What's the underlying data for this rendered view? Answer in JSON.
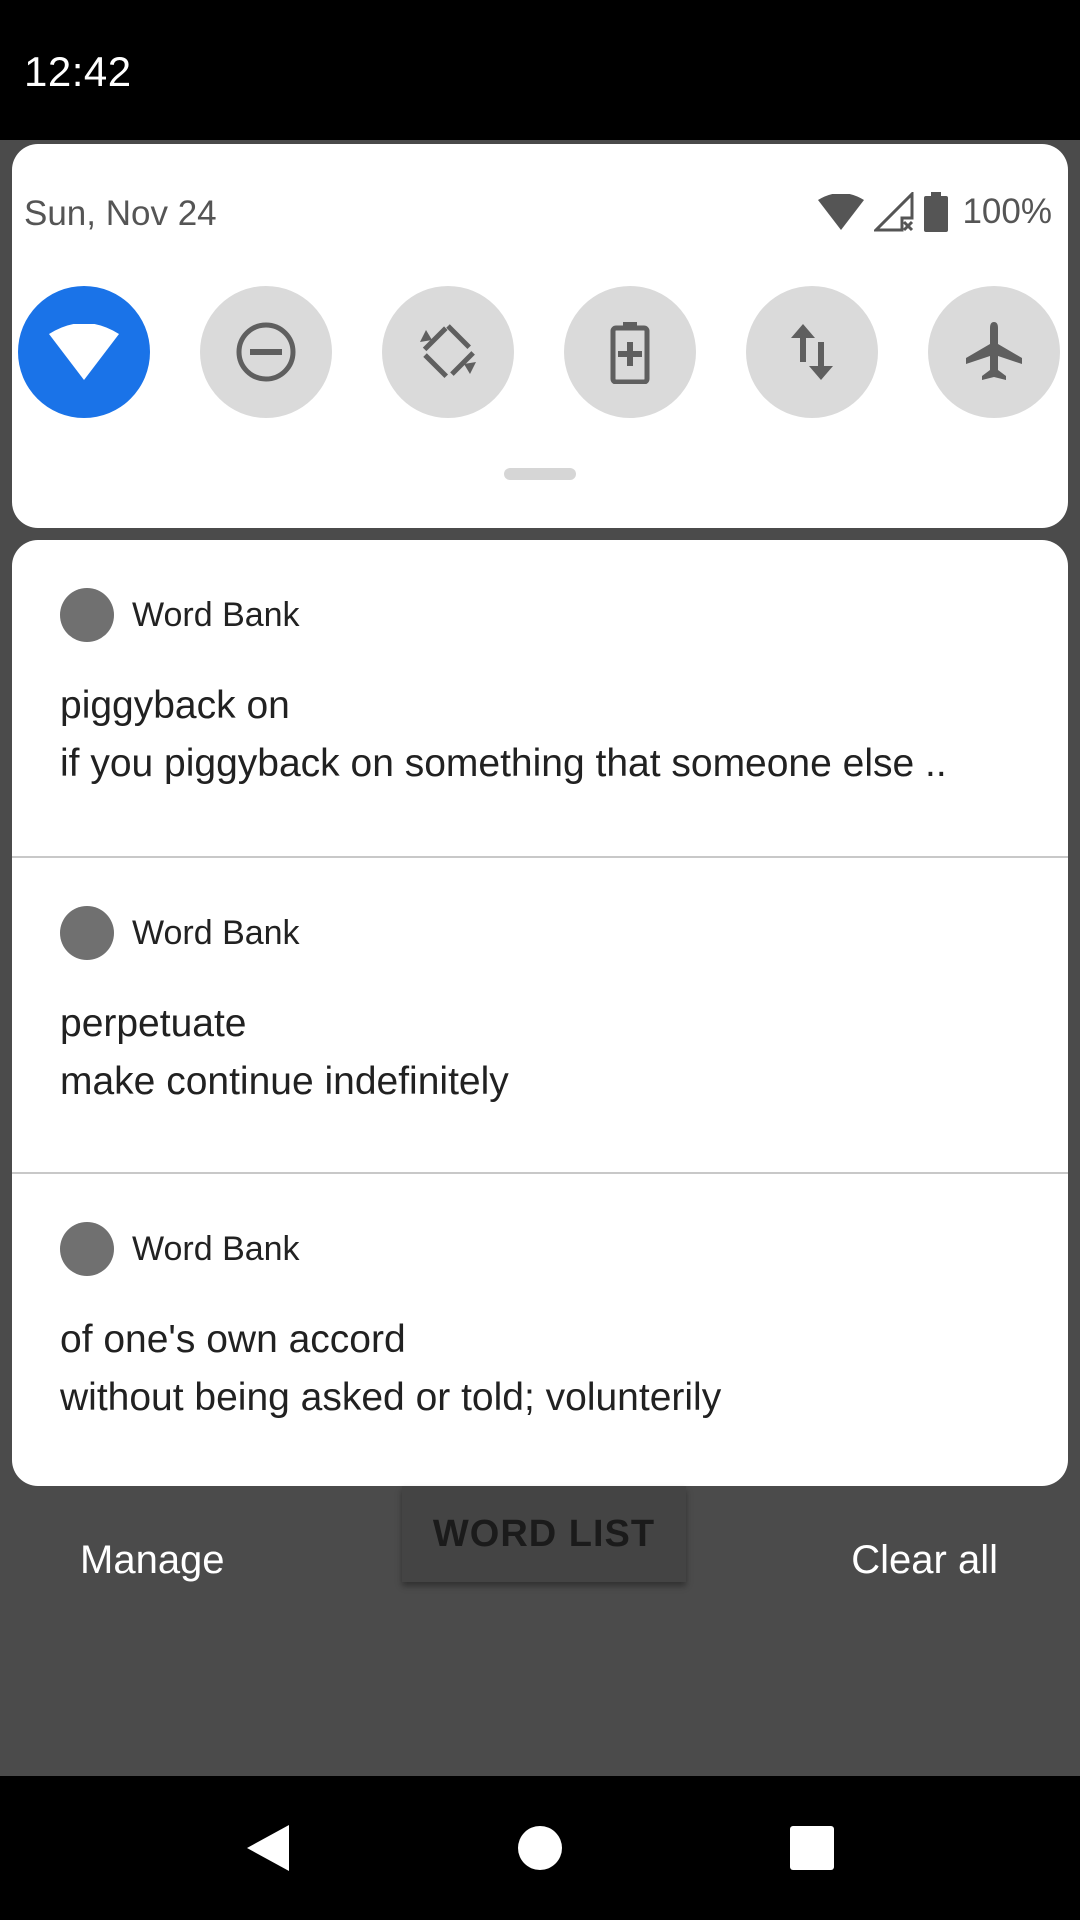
{
  "status_bar": {
    "time": "12:42"
  },
  "quick_settings": {
    "date": "Sun, Nov 24",
    "battery_percent": "100%",
    "tiles": [
      {
        "name": "wifi",
        "icon": "wifi-icon",
        "active": true
      },
      {
        "name": "do-not-disturb",
        "icon": "do-not-disturb-icon",
        "active": false
      },
      {
        "name": "auto-rotate",
        "icon": "auto-rotate-icon",
        "active": false
      },
      {
        "name": "battery-saver",
        "icon": "battery-saver-icon",
        "active": false
      },
      {
        "name": "mobile-data",
        "icon": "mobile-data-icon",
        "active": false
      },
      {
        "name": "airplane-mode",
        "icon": "airplane-icon",
        "active": false
      }
    ]
  },
  "notifications": [
    {
      "app": "Word Bank",
      "title": "piggyback on",
      "text": "if you piggyback on something that someone else .."
    },
    {
      "app": "Word Bank",
      "title": "perpetuate",
      "text": "make continue indefinitely"
    },
    {
      "app": "Word Bank",
      "title": "of one's own accord",
      "text": "without being asked or told; volunterily"
    }
  ],
  "actions": {
    "manage": "Manage",
    "clear_all": "Clear all",
    "word_list": "WORD LIST"
  },
  "colors": {
    "accent": "#1a73e8",
    "tile_inactive": "#dadada",
    "scrim": "#4b4b4b"
  }
}
